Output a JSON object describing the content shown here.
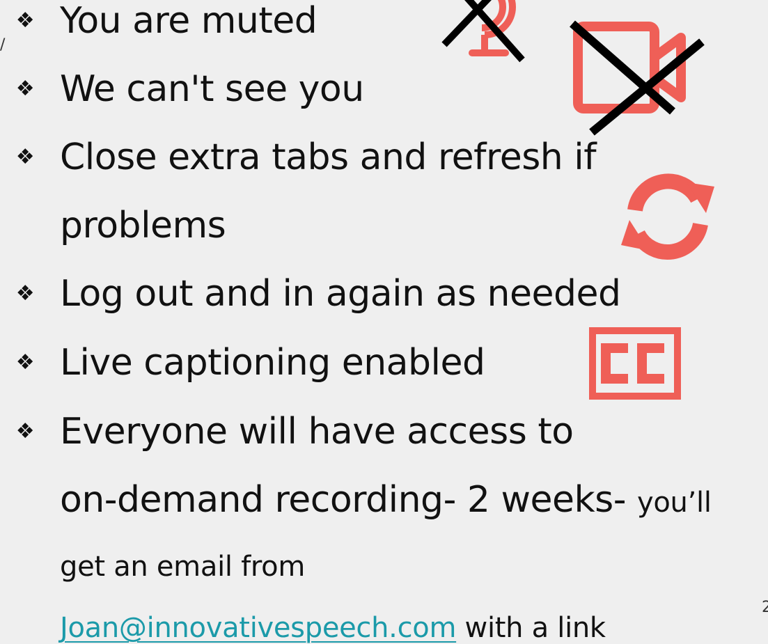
{
  "bullets": [
    {
      "marker": "❖",
      "text": "You are muted"
    },
    {
      "marker": "❖",
      "text": "We can't see you"
    },
    {
      "marker": "❖",
      "text": "Close extra tabs and refresh if",
      "cont": "problems"
    },
    {
      "marker": "❖",
      "text": "Log out and in again as needed"
    },
    {
      "marker": "❖",
      "text": "Live captioning enabled"
    },
    {
      "marker": "❖",
      "text": "Everyone will have access to",
      "line2_large": "on-demand recording- 2 weeks-",
      "line2_small": "you’ll",
      "line3": "get an email from",
      "link": "Joan@innovativespeech.com",
      "line4_rest": "with a link"
    }
  ],
  "page_number": "2",
  "edge_mark": "/",
  "icons": {
    "mic": "muted-microphone-icon",
    "camera": "muted-video-camera-icon",
    "refresh": "refresh-icon",
    "captions": "closed-captions-icon"
  },
  "colors": {
    "accent": "#ef5f57",
    "link": "#1b9aa9",
    "cross": "#000000"
  }
}
